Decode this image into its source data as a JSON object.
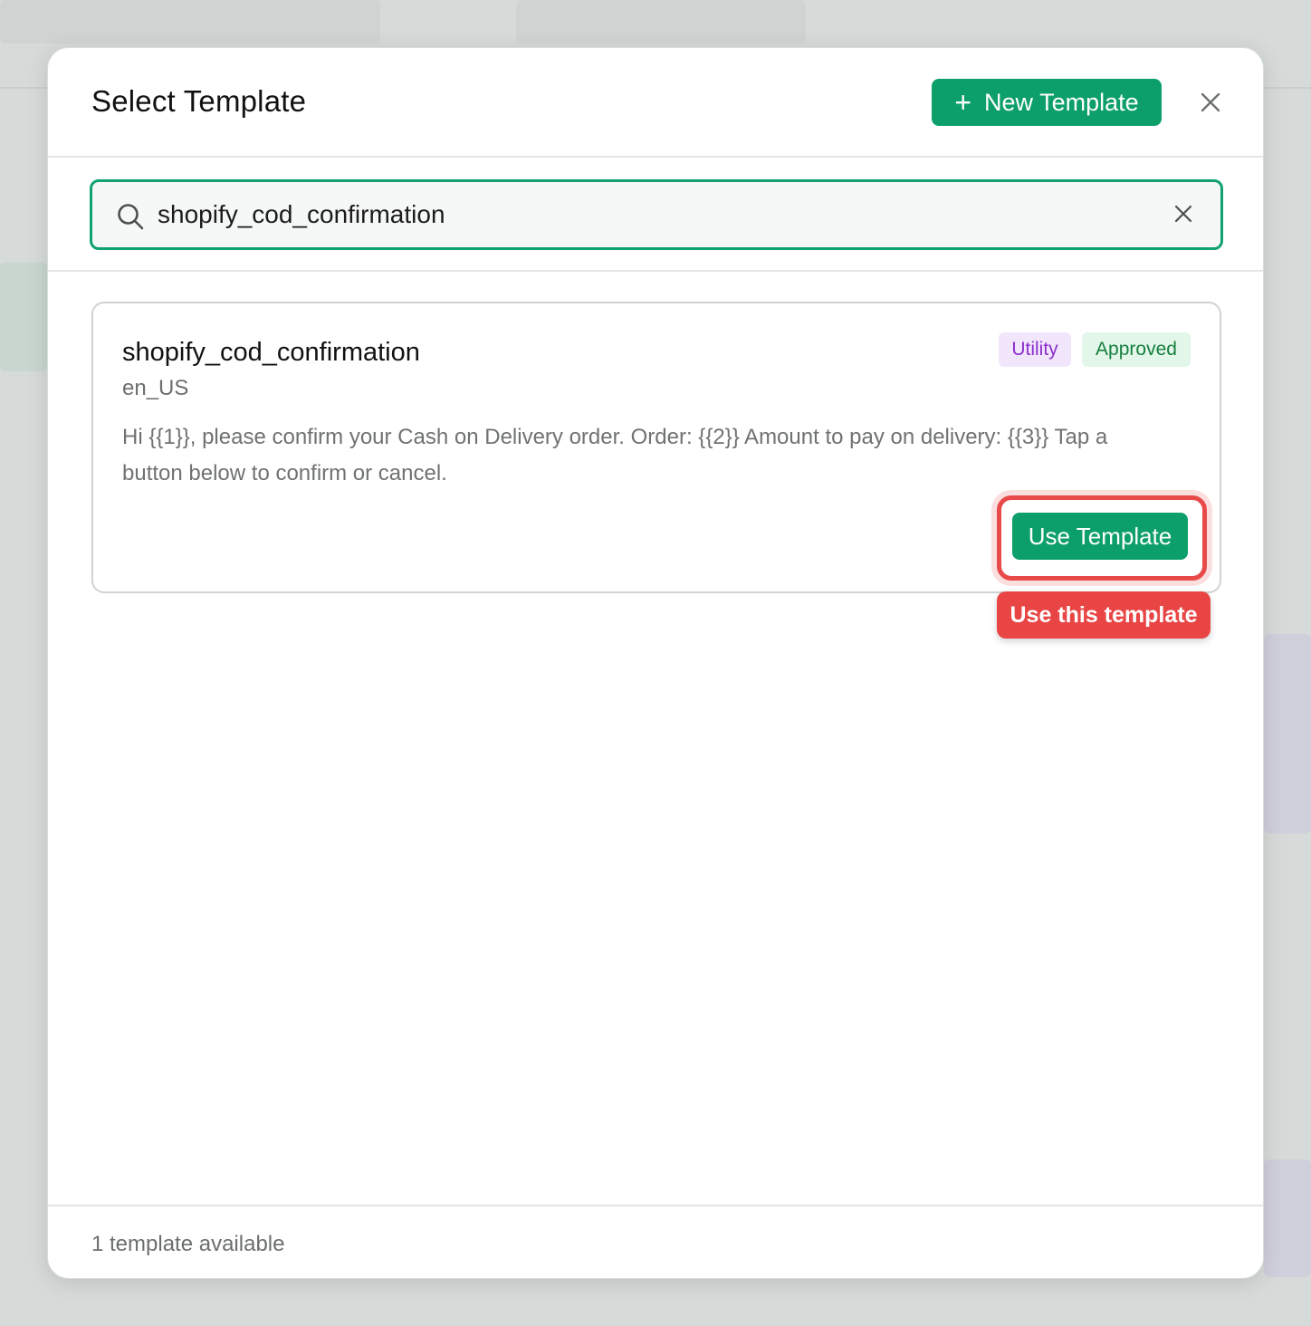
{
  "modal": {
    "title": "Select Template",
    "new_button_label": "New Template"
  },
  "search": {
    "value": "shopify_cod_confirmation"
  },
  "templates": [
    {
      "name": "shopify_cod_confirmation",
      "language": "en_US",
      "category": "Utility",
      "status": "Approved",
      "body": "Hi {{1}}, please confirm your Cash on Delivery order. Order: {{2}} Amount to pay on delivery: {{3}} Tap a button below to confirm or cancel.",
      "use_button_label": "Use Template"
    }
  ],
  "tooltip": {
    "text": "Use this template"
  },
  "footer": {
    "count_text": "1 template available"
  },
  "colors": {
    "primary_green": "#0d9f6a",
    "highlight_red": "#e94545",
    "utility_purple": "#8e2fcf",
    "approved_green": "#17803f"
  },
  "icons": {
    "new": "plus-icon",
    "close": "close-icon",
    "search": "search-icon",
    "clear": "clear-icon"
  }
}
